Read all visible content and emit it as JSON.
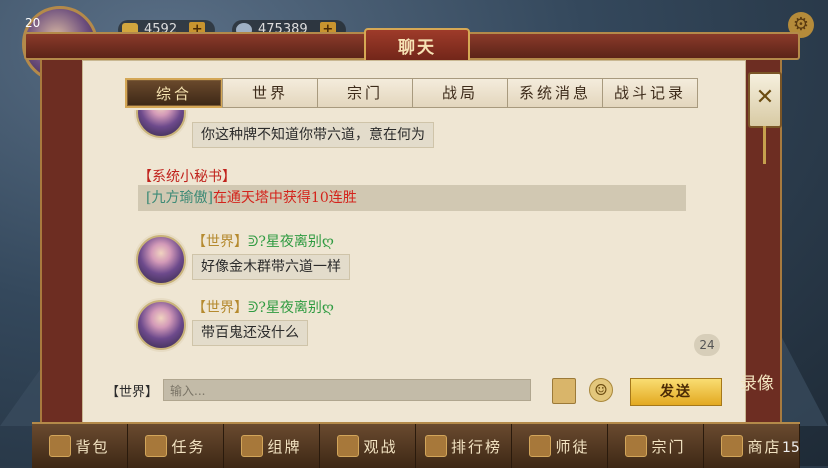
{
  "topbar": {
    "level": "20",
    "currency1": "4592",
    "currency2": "475389"
  },
  "panel": {
    "title": "聊天",
    "tabs": [
      "综合",
      "世界",
      "宗门",
      "战局",
      "系统消息",
      "战斗记录"
    ],
    "active_tab": "综合"
  },
  "chat": {
    "msg0_text": "你这种牌不知道你带六道，意在何为",
    "system_header": "【系统小秘书】",
    "system_who": "[九方瑜傲]",
    "system_msg": "在通天塔中获得10连胜",
    "msg1": {
      "channel": "【世界】",
      "name": "ᕲ?星夜离别ღ",
      "text": "好像金木群带六道一样"
    },
    "msg2": {
      "channel": "【世界】",
      "name": "ᕲ?星夜离别ღ",
      "text": "带百鬼还没什么"
    },
    "unread_count": "24"
  },
  "input": {
    "channel_label": "【世界】",
    "placeholder": "输入...",
    "send_label": "发送"
  },
  "side": {
    "record_label": "录像"
  },
  "bottom_nav": [
    "背包",
    "任务",
    "组牌",
    "观战",
    "排行榜",
    "师徒",
    "宗门",
    "商店"
  ],
  "bottom_count": "15",
  "colors": {
    "accent_red": "#c0221c",
    "name_green": "#2f9b41",
    "send_gold": "#e3a921"
  }
}
